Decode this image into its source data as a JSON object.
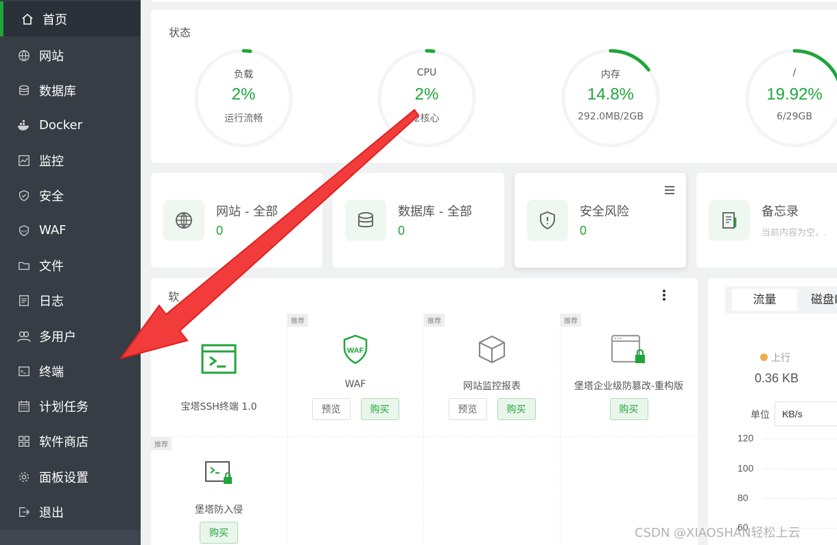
{
  "sidebar": {
    "items": [
      {
        "label": "首页",
        "icon": "home-icon",
        "active": true
      },
      {
        "label": "网站",
        "icon": "globe-icon"
      },
      {
        "label": "数据库",
        "icon": "database-icon"
      },
      {
        "label": "Docker",
        "icon": "docker-icon"
      },
      {
        "label": "监控",
        "icon": "monitor-icon"
      },
      {
        "label": "安全",
        "icon": "shield-icon"
      },
      {
        "label": "WAF",
        "icon": "waf-icon"
      },
      {
        "label": "文件",
        "icon": "folder-icon"
      },
      {
        "label": "日志",
        "icon": "log-icon"
      },
      {
        "label": "多用户",
        "icon": "users-icon"
      },
      {
        "label": "终端",
        "icon": "terminal-icon"
      },
      {
        "label": "计划任务",
        "icon": "calendar-icon"
      },
      {
        "label": "软件商店",
        "icon": "grid-icon"
      },
      {
        "label": "面板设置",
        "icon": "gear-icon"
      },
      {
        "label": "退出",
        "icon": "logout-icon"
      }
    ]
  },
  "status": {
    "title": "状态",
    "gauges": [
      {
        "title": "负载",
        "value": "2%",
        "sub": "运行流畅",
        "percent": 0.02
      },
      {
        "title": "CPU",
        "value": "2%",
        "sub": "2核心",
        "percent": 0.02
      },
      {
        "title": "内存",
        "value": "14.8%",
        "sub": "292.0MB/2GB",
        "percent": 0.148
      },
      {
        "title": "/",
        "value": "19.92%",
        "sub": "6/29GB",
        "percent": 0.1992
      }
    ]
  },
  "overview": [
    {
      "title": "网站 - 全部",
      "value": "0",
      "icon": "globe-icon"
    },
    {
      "title": "数据库 - 全部",
      "value": "0",
      "icon": "database-icon"
    },
    {
      "title": "安全风险",
      "value": "0",
      "icon": "shield-alert-icon"
    },
    {
      "title": "备忘录",
      "sub": "当前内容为空，.",
      "icon": "memo-icon"
    }
  ],
  "software": {
    "title": "软",
    "tag": "推荐",
    "preview_label": "预览",
    "buy_label": "购买",
    "items": [
      {
        "name": "宝塔SSH终端 1.0"
      },
      {
        "name": "WAF"
      },
      {
        "name": "网站监控报表"
      },
      {
        "name": "堡塔企业级防篡改-重构版"
      },
      {
        "name": "堡塔防入侵"
      }
    ]
  },
  "traffic": {
    "tabs": [
      "流量",
      "磁盘I"
    ],
    "up_label": "上行",
    "up_value": "0.36 KB",
    "unit_label": "单位",
    "unit_value": "KB/s",
    "y_ticks": [
      "120",
      "100",
      "80",
      "60"
    ]
  },
  "watermark": "CSDN @XIAOSHAN轻松上云",
  "colors": {
    "accent": "#20a53a",
    "sidebar": "#363d45",
    "arrow": "#f23b3b"
  }
}
